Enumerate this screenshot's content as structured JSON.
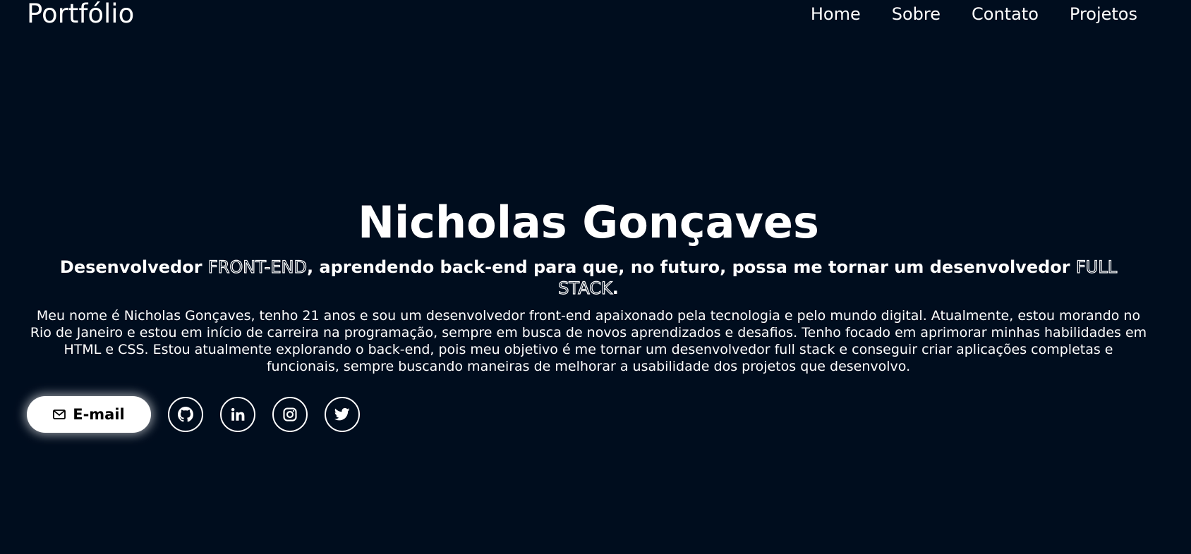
{
  "header": {
    "logo": "Portfólio",
    "nav": [
      "Home",
      "Sobre",
      "Contato",
      "Projetos"
    ]
  },
  "hero": {
    "name": "Nicholas Gonçaves",
    "subtitle_part1": "Desenvolvedor ",
    "subtitle_highlight1": "FRONT-END",
    "subtitle_part2": ", aprendendo back-end para que, no futuro, possa me tornar um desenvolvedor ",
    "subtitle_highlight2": "FULL STACK",
    "subtitle_part3": ".",
    "bio": "Meu nome é Nicholas Gonçaves, tenho 21 anos e sou um desenvolvedor front-end apaixonado pela tecnologia e pelo mundo digital. Atualmente, estou morando no Rio de Janeiro e estou em início de carreira na programação, sempre em busca de novos aprendizados e desafios. Tenho focado em aprimorar minhas habilidades em HTML e CSS. Estou atualmente explorando o back-end, pois meu objetivo é me tornar um desenvolvedor full stack e conseguir criar aplicações completas e funcionais, sempre buscando maneiras de melhorar a usabilidade dos projetos que desenvolvo."
  },
  "actions": {
    "email_label": "E-mail",
    "email_icon": "mail-icon",
    "social_icons": [
      "github-icon",
      "linkedin-icon",
      "instagram-icon",
      "twitter-icon"
    ]
  },
  "colors": {
    "background": "#000d1e",
    "text": "#ffffff",
    "button_bg": "#ffffff",
    "button_text": "#000000"
  }
}
